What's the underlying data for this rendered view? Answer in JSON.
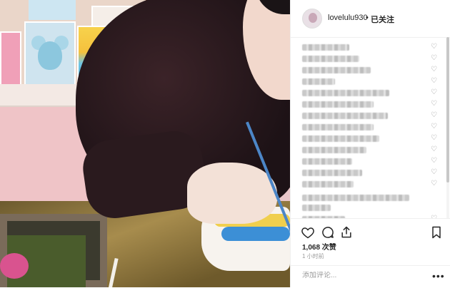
{
  "header": {
    "username": "lovelulu930",
    "separator": "•",
    "follow_label": "已关注"
  },
  "comments": {
    "count_visible": 16,
    "blurred": true
  },
  "actions": {
    "like_icon": "heart-icon",
    "comment_icon": "comment-icon",
    "share_icon": "share-icon",
    "save_icon": "bookmark-icon"
  },
  "stats": {
    "likes": "1,068 次赞",
    "time": "1 小时前"
  },
  "comment_box": {
    "placeholder": "添加评论...",
    "more_label": "•••"
  },
  "colors": {
    "text": "#262626",
    "muted": "#999999",
    "border": "#efefef"
  }
}
